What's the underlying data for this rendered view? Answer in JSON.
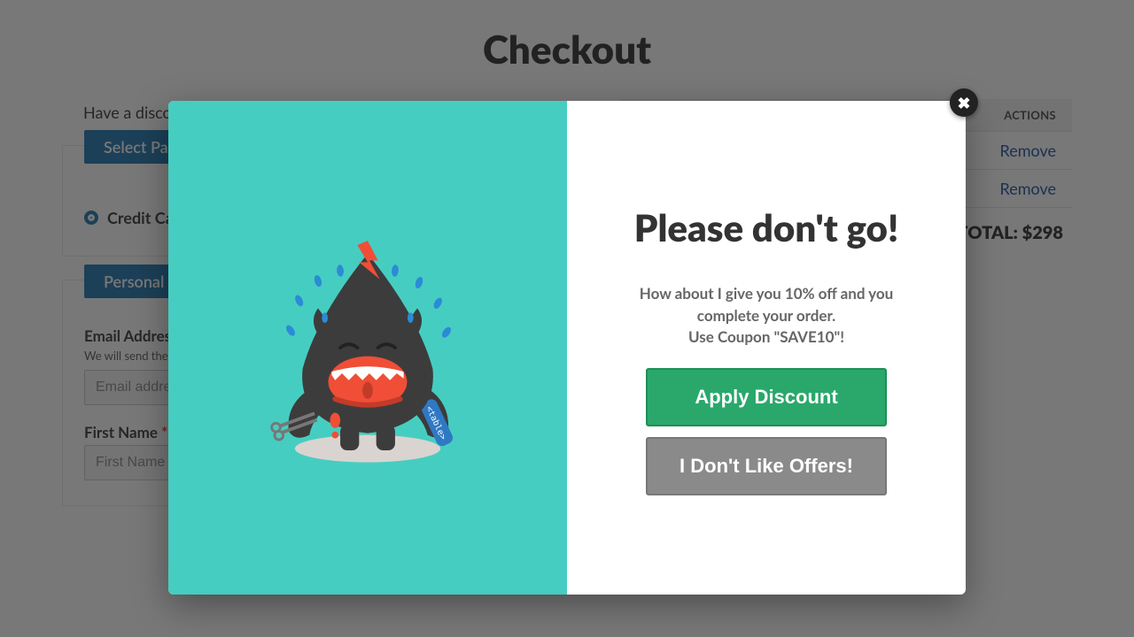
{
  "page": {
    "title": "Checkout",
    "discount_prompt": "Have a discount code?"
  },
  "payment": {
    "panel_title": "Select Payment",
    "credit_card_label": "Credit Card"
  },
  "personal": {
    "panel_title": "Personal Info",
    "email_label": "Email Address",
    "email_help": "We will send the purchase receipt to this address.",
    "email_placeholder": "Email address",
    "first_name_label": "First Name",
    "first_name_placeholder": "First Name"
  },
  "cart": {
    "actions_header": "ACTIONS",
    "rows": [
      {
        "remove": "Remove"
      },
      {
        "remove": "Remove"
      }
    ],
    "total_label": "TOTAL:",
    "total_value": "$298"
  },
  "modal": {
    "title": "Please don't go!",
    "body_line1": "How about I give you 10% off and you complete your order.",
    "body_line2": "Use Coupon \"SAVE10\"!",
    "apply_label": "Apply Discount",
    "decline_label": "I Don't Like Offers!"
  }
}
